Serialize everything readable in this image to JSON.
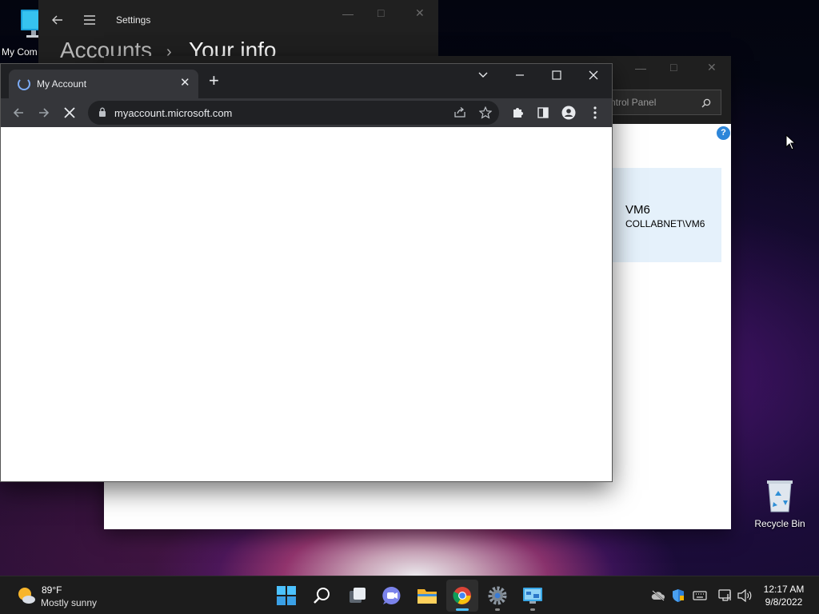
{
  "desktop": {
    "icons": [
      {
        "label": "My Com",
        "icon": "my-computer-icon"
      },
      {
        "label": "Recycle Bin",
        "icon": "recycle-bin-icon"
      }
    ]
  },
  "settings_window": {
    "title": "Settings",
    "breadcrumb_parent": "Accounts",
    "breadcrumb_separator": "›",
    "breadcrumb_current": "Your info"
  },
  "control_panel_window": {
    "search_placeholder": "ntrol Panel",
    "help_label": "?",
    "user_card": {
      "name": "VM6",
      "account": "COLLABNET\\VM6"
    }
  },
  "browser": {
    "tab_title": "My Account",
    "url": "myaccount.microsoft.com",
    "state": "loading"
  },
  "taskbar": {
    "weather_temp": "89°F",
    "weather_condition": "Mostly sunny",
    "apps": [
      "start-icon",
      "search-icon",
      "task-view-icon",
      "chat-icon",
      "file-explorer-icon",
      "chrome-icon",
      "settings-icon",
      "control-panel-icon"
    ],
    "active_app": "chrome-icon",
    "time": "12:17 AM",
    "date": "9/8/2022"
  },
  "colors": {
    "accent": "#4cc2ff",
    "help_badge": "#2d86d9",
    "user_card_bg": "#e5f1fb"
  }
}
